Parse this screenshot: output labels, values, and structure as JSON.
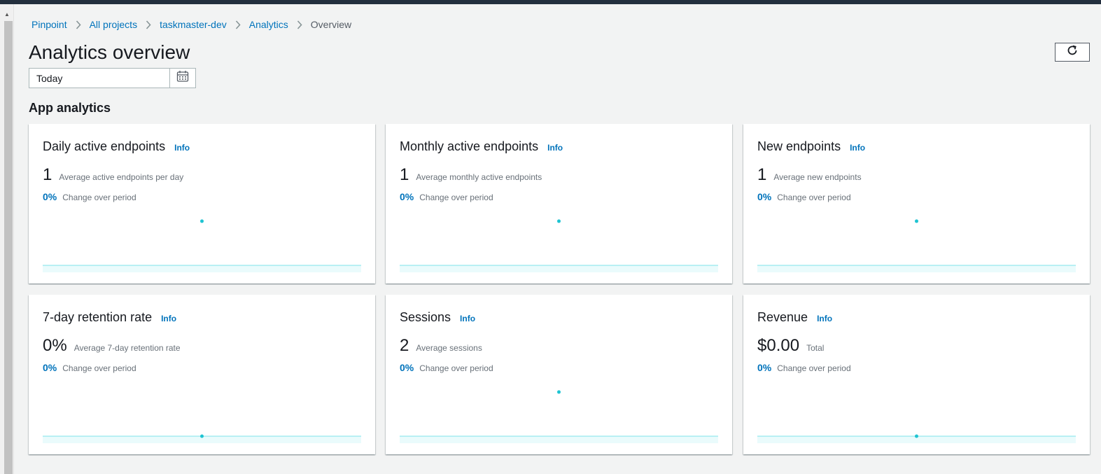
{
  "breadcrumb": {
    "items": [
      "Pinpoint",
      "All projects",
      "taskmaster-dev",
      "Analytics"
    ],
    "current": "Overview"
  },
  "page": {
    "title": "Analytics overview",
    "date_range": "Today",
    "section_title": "App analytics"
  },
  "icons": {
    "refresh": "refresh-icon",
    "calendar": "calendar-icon",
    "separator": "chevron-right-icon"
  },
  "colors": {
    "link": "#0073bb",
    "chart_point": "#1fc4d2",
    "chart_line": "#7ee3ea",
    "chart_fill": "#eafbfc"
  },
  "cards": [
    {
      "title": "Daily active endpoints",
      "info": "Info",
      "value": "1",
      "description": "Average active endpoints per day",
      "change": "0%",
      "change_label": "Change over period"
    },
    {
      "title": "Monthly active endpoints",
      "info": "Info",
      "value": "1",
      "description": "Average monthly active endpoints",
      "change": "0%",
      "change_label": "Change over period"
    },
    {
      "title": "New endpoints",
      "info": "Info",
      "value": "1",
      "description": "Average new endpoints",
      "change": "0%",
      "change_label": "Change over period"
    },
    {
      "title": "7-day retention rate",
      "info": "Info",
      "value": "0%",
      "description": "Average 7-day retention rate",
      "change": "0%",
      "change_label": "Change over period"
    },
    {
      "title": "Sessions",
      "info": "Info",
      "value": "2",
      "description": "Average sessions",
      "change": "0%",
      "change_label": "Change over period"
    },
    {
      "title": "Revenue",
      "info": "Info",
      "value": "$0.00",
      "description": "Total",
      "change": "0%",
      "change_label": "Change over period"
    }
  ],
  "chart_data": [
    {
      "type": "area",
      "series": [
        {
          "values": [
            1
          ]
        }
      ],
      "ylim": [
        0,
        1.3
      ]
    },
    {
      "type": "area",
      "series": [
        {
          "values": [
            1
          ]
        }
      ],
      "ylim": [
        0,
        1.3
      ]
    },
    {
      "type": "area",
      "series": [
        {
          "values": [
            1
          ]
        }
      ],
      "ylim": [
        0,
        1.3
      ]
    },
    {
      "type": "area",
      "series": [
        {
          "values": [
            0
          ]
        }
      ],
      "ylim": [
        0,
        1.3
      ]
    },
    {
      "type": "area",
      "series": [
        {
          "values": [
            2
          ]
        }
      ],
      "ylim": [
        0,
        2.6
      ]
    },
    {
      "type": "area",
      "series": [
        {
          "values": [
            0
          ]
        }
      ],
      "ylim": [
        0,
        1.3
      ]
    }
  ]
}
